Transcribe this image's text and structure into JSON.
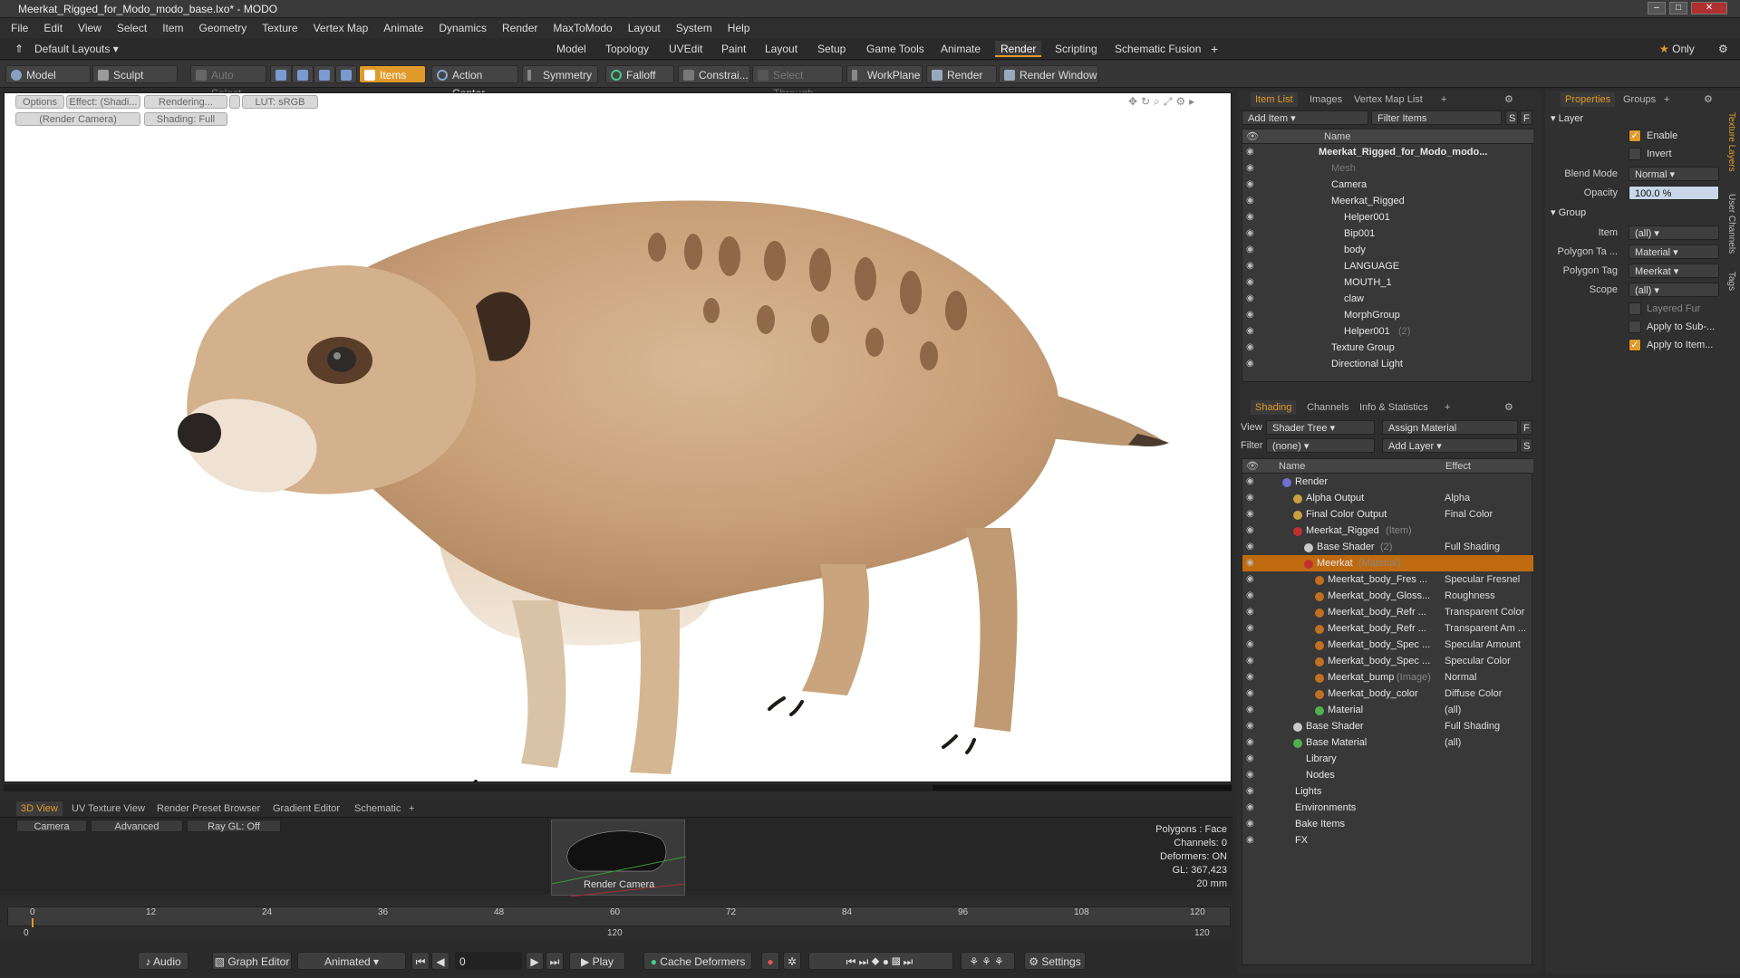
{
  "window": {
    "title": "Meerkat_Rigged_for_Modo_modo_base.lxo* - MODO"
  },
  "menu": [
    "File",
    "Edit",
    "View",
    "Select",
    "Item",
    "Geometry",
    "Texture",
    "Vertex Map",
    "Animate",
    "Dynamics",
    "Render",
    "MaxToModo",
    "Layout",
    "System",
    "Help"
  ],
  "layoutbar": {
    "layouts_label": "Default Layouts",
    "tabs": [
      "Model",
      "Topology",
      "UVEdit",
      "Paint",
      "Layout",
      "Setup",
      "Game Tools",
      "Animate",
      "Render",
      "Scripting",
      "Schematic Fusion"
    ],
    "active_tab": "Render",
    "only_label": "Only"
  },
  "toolbar": {
    "model": "Model",
    "sculpt": "Sculpt",
    "auto_select": "Auto Select",
    "items": "Items",
    "action_center": "Action Center",
    "symmetry": "Symmetry",
    "falloff": "Falloff",
    "constraints": "Constrai...",
    "select_through": "Select Through",
    "workplane": "WorkPlane",
    "render": "Render",
    "render_window": "Render Window"
  },
  "viewport": {
    "buttons": [
      "Options",
      "Effect: (Shadi...",
      "Rendering...",
      "LUT: sRGB",
      "(Render Camera)",
      "Shading: Full"
    ]
  },
  "bottom": {
    "tabs": [
      "3D View",
      "UV Texture View",
      "Render Preset Browser",
      "Gradient Editor",
      "Schematic"
    ],
    "active_tab": "3D View",
    "buttons": [
      "Camera",
      "Advanced",
      "Ray GL: Off"
    ],
    "render_camera": "Render Camera",
    "stats": [
      "Polygons : Face",
      "Channels: 0",
      "Deformers: ON",
      "GL: 367,423",
      "20 mm"
    ]
  },
  "timeline": {
    "ticks": [
      "0",
      "12",
      "24",
      "36",
      "48",
      "60",
      "72",
      "84",
      "96",
      "108",
      "120"
    ],
    "under_left": "0",
    "under_mid": "120",
    "under_right": "120"
  },
  "transport": {
    "audio": "Audio",
    "graph_editor": "Graph Editor",
    "animated": "Animated",
    "frame": "0",
    "play": "Play",
    "cache": "Cache Deformers",
    "settings": "Settings"
  },
  "itemlist": {
    "tabs": [
      "Item List",
      "Images",
      "Vertex Map List"
    ],
    "active_tab": "Item List",
    "add_item": "Add Item",
    "filter_items": "Filter Items",
    "s": "S",
    "f": "F",
    "col_name": "Name",
    "rows": [
      {
        "label": "Meerkat_Rigged_for_Modo_modo...",
        "indent": 0,
        "bold": true
      },
      {
        "label": "Mesh",
        "indent": 1,
        "dim": true
      },
      {
        "label": "Camera",
        "indent": 1
      },
      {
        "label": "Meerkat_Rigged",
        "indent": 1
      },
      {
        "label": "Helper001",
        "indent": 2
      },
      {
        "label": "Bip001",
        "indent": 2
      },
      {
        "label": "body",
        "indent": 2
      },
      {
        "label": "LANGUAGE",
        "indent": 2
      },
      {
        "label": "MOUTH_1",
        "indent": 2
      },
      {
        "label": "claw",
        "indent": 2
      },
      {
        "label": "MorphGroup",
        "indent": 2
      },
      {
        "label": "Helper001",
        "indent": 2,
        "suffix": "(2)"
      },
      {
        "label": "Texture Group",
        "indent": 1
      },
      {
        "label": "Directional Light",
        "indent": 1
      }
    ]
  },
  "shading": {
    "tabs": [
      "Shading",
      "Channels",
      "Info & Statistics"
    ],
    "active_tab": "Shading",
    "view_label": "View",
    "view_value": "Shader Tree",
    "assign_material": "Assign Material",
    "filter_label": "Filter",
    "filter_value": "(none)",
    "add_layer": "Add Layer",
    "f": "F",
    "s": "S",
    "col_name": "Name",
    "col_effect": "Effect",
    "rows": [
      {
        "label": "Render",
        "indent": 0,
        "effect": "",
        "color": "#7070d0"
      },
      {
        "label": "Alpha Output",
        "indent": 1,
        "effect": "Alpha",
        "color": "#c8a040"
      },
      {
        "label": "Final Color Output",
        "indent": 1,
        "effect": "Final Color",
        "color": "#c8a040"
      },
      {
        "label": "Meerkat_Rigged",
        "indent": 1,
        "suffix": "(Item)",
        "effect": "",
        "color": "#c03030"
      },
      {
        "label": "Base Shader",
        "indent": 2,
        "suffix": "(2)",
        "effect": "Full Shading",
        "color": "#c8c8c8"
      },
      {
        "label": "Meerkat",
        "indent": 2,
        "suffix": "(Material)",
        "effect": "",
        "color": "#c03030",
        "selected": true
      },
      {
        "label": "Meerkat_body_Fres ...",
        "indent": 3,
        "effect": "Specular Fresnel",
        "color": "#c07020"
      },
      {
        "label": "Meerkat_body_Gloss...",
        "indent": 3,
        "effect": "Roughness",
        "color": "#c07020"
      },
      {
        "label": "Meerkat_body_Refr ...",
        "indent": 3,
        "effect": "Transparent Color",
        "color": "#c07020"
      },
      {
        "label": "Meerkat_body_Refr ...",
        "indent": 3,
        "effect": "Transparent Am ...",
        "color": "#c07020"
      },
      {
        "label": "Meerkat_body_Spec ...",
        "indent": 3,
        "effect": "Specular Amount",
        "color": "#c07020"
      },
      {
        "label": "Meerkat_body_Spec ...",
        "indent": 3,
        "effect": "Specular Color",
        "color": "#c07020"
      },
      {
        "label": "Meerkat_bump",
        "indent": 3,
        "suffix": "(Image)",
        "effect": "Normal",
        "color": "#c07020"
      },
      {
        "label": "Meerkat_body_color",
        "indent": 3,
        "effect": "Diffuse Color",
        "color": "#c07020"
      },
      {
        "label": "Material",
        "indent": 3,
        "effect": "(all)",
        "color": "#50b050"
      },
      {
        "label": "Base Shader",
        "indent": 1,
        "effect": "Full Shading",
        "color": "#c8c8c8"
      },
      {
        "label": "Base Material",
        "indent": 1,
        "effect": "(all)",
        "color": "#50b050"
      },
      {
        "label": "Library",
        "indent": 1,
        "effect": "",
        "color": ""
      },
      {
        "label": "Nodes",
        "indent": 1,
        "effect": "",
        "color": ""
      },
      {
        "label": "Lights",
        "indent": 0,
        "effect": "",
        "color": ""
      },
      {
        "label": "Environments",
        "indent": 0,
        "effect": "",
        "color": ""
      },
      {
        "label": "Bake Items",
        "indent": 0,
        "effect": "",
        "color": ""
      },
      {
        "label": "FX",
        "indent": 0,
        "effect": "",
        "color": ""
      }
    ]
  },
  "properties": {
    "tabs": [
      "Properties",
      "Groups"
    ],
    "active_tab": "Properties",
    "section_layer": "Layer",
    "enable": "Enable",
    "invert": "Invert",
    "blend_mode_label": "Blend Mode",
    "blend_mode": "Normal",
    "opacity_label": "Opacity",
    "opacity": "100.0 %",
    "section_group": "Group",
    "item_label": "Item",
    "item_value": "(all)",
    "poly_type_label": "Polygon Ta ...",
    "poly_type": "Material",
    "poly_tag_label": "Polygon Tag",
    "poly_tag": "Meerkat",
    "scope_label": "Scope",
    "scope": "(all)",
    "layered_fur": "Layered Fur",
    "apply_sub": "Apply to Sub-...",
    "apply_item": "Apply to Item...",
    "side_tabs": [
      "Texture Layers",
      "User Channels",
      "Tags"
    ]
  },
  "colors": {
    "accent": "#e09a2a",
    "bg": "#2b2b2b"
  }
}
